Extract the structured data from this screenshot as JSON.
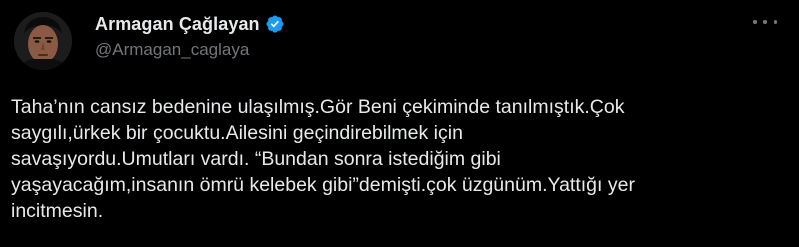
{
  "tweet": {
    "author": {
      "display_name": "Armagan Çağlayan",
      "handle": "@Armagan_caglaya",
      "verified": true,
      "avatar_icon": "profile-photo"
    },
    "more_icon": "more-horizontal-icon",
    "text": "Taha’nın cansız bedenine ulaşılmış.Gör Beni çekiminde tanılmıştık.Çok\nsaygılı,ürkek bir çocuktu.Ailesini geçindirebilmek için\nsavaşıyordu.Umutları vardı. “Bundan sonra istediğim gibi\nyaşayacağım,insanın ömrü kelebek gibi”demişti.çok üzgünüm.Yattığı yer\nincitmesin."
  },
  "colors": {
    "background": "#000000",
    "text_primary": "#e7e9ea",
    "text_secondary": "#71767b",
    "verified_badge": "#1d9bf0"
  }
}
